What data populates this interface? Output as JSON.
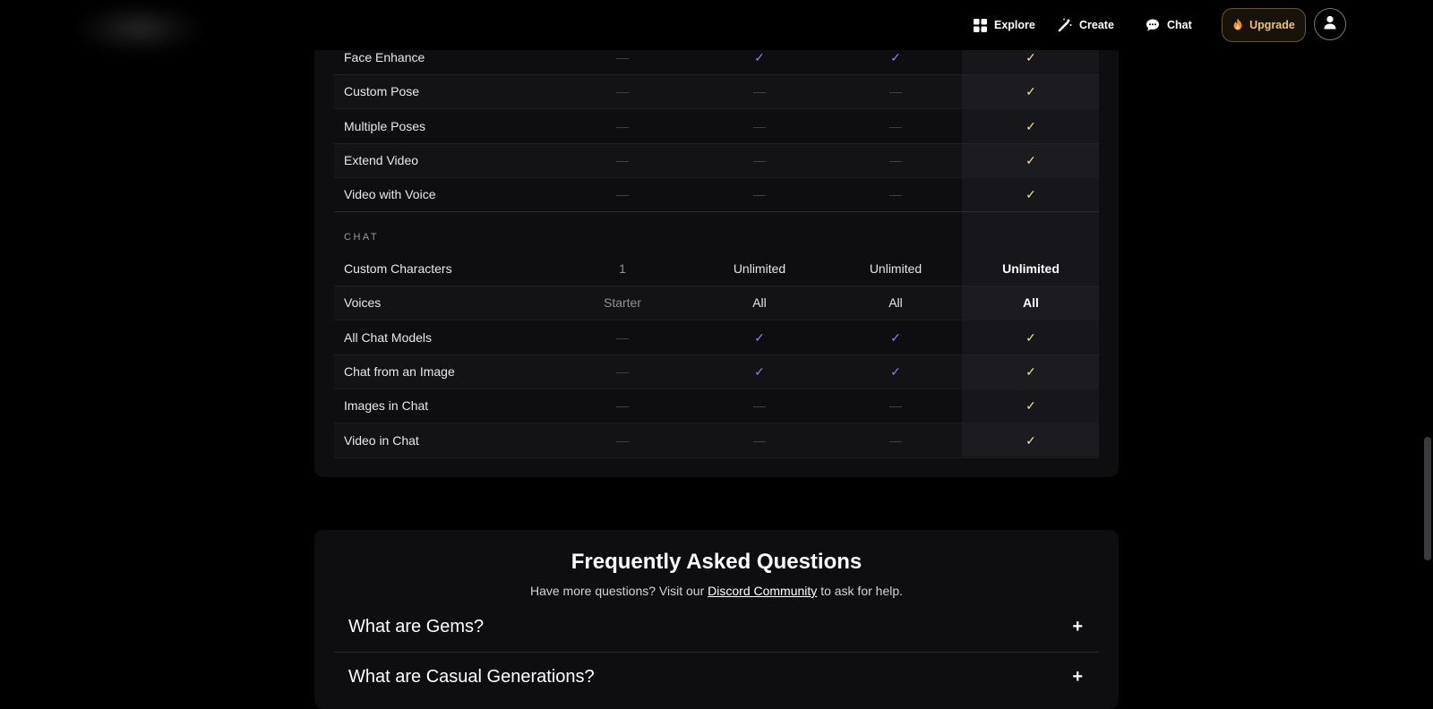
{
  "nav": {
    "explore": "Explore",
    "create": "Create",
    "chat": "Chat",
    "upgrade": "Upgrade",
    "upgrade_icon": "flame-icon",
    "avatar_icon": "user-icon"
  },
  "table": {
    "top_rows": [
      {
        "label": "Face Enhance",
        "cells": [
          "—",
          "✓",
          "✓",
          "✓"
        ]
      },
      {
        "label": "Custom Pose",
        "cells": [
          "—",
          "—",
          "—",
          "✓"
        ]
      },
      {
        "label": "Multiple Poses",
        "cells": [
          "—",
          "—",
          "—",
          "✓"
        ]
      },
      {
        "label": "Extend Video",
        "cells": [
          "—",
          "—",
          "—",
          "✓"
        ]
      },
      {
        "label": "Video with Voice",
        "cells": [
          "—",
          "—",
          "—",
          "✓"
        ]
      }
    ],
    "chat_section": "CHAT",
    "chat_rows": [
      {
        "label": "Custom Characters",
        "cells": [
          "1",
          "Unlimited",
          "Unlimited",
          "Unlimited"
        ]
      },
      {
        "label": "Voices",
        "cells": [
          "Starter",
          "All",
          "All",
          "All"
        ]
      },
      {
        "label": "All Chat Models",
        "cells": [
          "—",
          "✓",
          "✓",
          "✓"
        ]
      },
      {
        "label": "Chat from an Image",
        "cells": [
          "—",
          "✓",
          "✓",
          "✓"
        ]
      },
      {
        "label": "Images in Chat",
        "cells": [
          "—",
          "—",
          "—",
          "✓"
        ]
      },
      {
        "label": "Video in Chat",
        "cells": [
          "—",
          "—",
          "—",
          "✓"
        ]
      }
    ]
  },
  "faq": {
    "title": "Frequently Asked Questions",
    "subtitle_pre": "Have more questions? Visit our",
    "subtitle_link": "Discord Community",
    "subtitle_post": "to ask for help.",
    "items": [
      {
        "question": "What are Gems?"
      },
      {
        "question": "What are Casual Generations?"
      }
    ]
  },
  "colors": {
    "accent_purple": "#8b7ff0",
    "accent_gold": "#f2dfa0",
    "upgrade_text": "#f1c271"
  }
}
